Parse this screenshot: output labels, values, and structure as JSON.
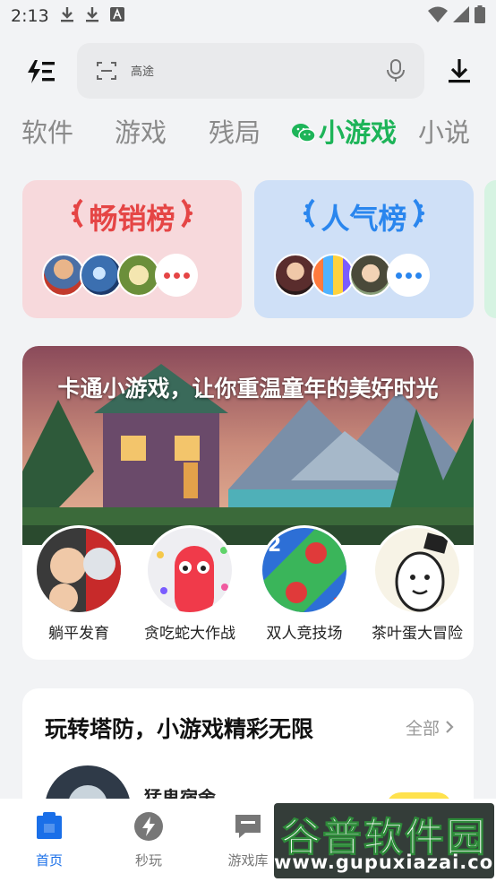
{
  "status": {
    "time": "2:13"
  },
  "search": {
    "placeholder": "高途"
  },
  "tabs": [
    {
      "label": "软件"
    },
    {
      "label": "游戏"
    },
    {
      "label": "残局"
    },
    {
      "label": "小游戏"
    },
    {
      "label": "小说"
    }
  ],
  "ranks": [
    {
      "title": "畅销榜",
      "color": "#e54545",
      "bg": "#f7d9dc"
    },
    {
      "title": "人气榜",
      "color": "#2a86ee",
      "bg": "#cfe0f7"
    }
  ],
  "banner": {
    "title": "卡通小游戏，让你重温童年的美好时光",
    "games": [
      {
        "name": "躺平发育"
      },
      {
        "name": "贪吃蛇大作战"
      },
      {
        "name": "双人竞技场"
      },
      {
        "name": "茶叶蛋大冒险"
      }
    ]
  },
  "section": {
    "title": "玩转塔防，小游戏精彩无限",
    "all_label": "全部",
    "first_item": "猛鬼宿舍"
  },
  "nav": [
    {
      "label": "首页",
      "active": true
    },
    {
      "label": "秒玩"
    },
    {
      "label": "游戏库"
    }
  ],
  "watermark": {
    "title": "谷普软件园",
    "url": "www.gupuxiazai.com"
  },
  "colors": {
    "accent_green": "#1db458",
    "nav_active": "#1a6fe8"
  }
}
